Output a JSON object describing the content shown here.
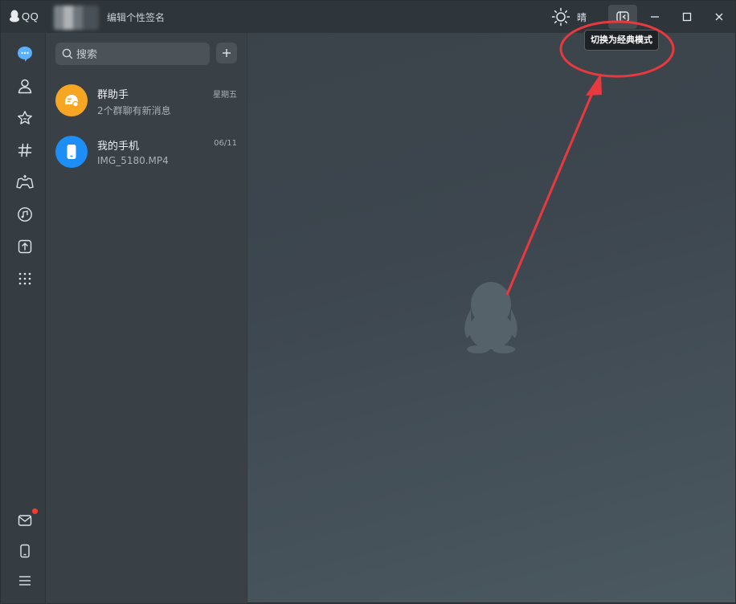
{
  "titlebar": {
    "logo_text": "QQ",
    "signature": "编辑个性签名",
    "weather_icon": "sun-icon",
    "weather_text": "晴",
    "switch_mode_icon": "switch-mode-icon",
    "tooltip": "切换为经典模式"
  },
  "nav": {
    "items": [
      {
        "name": "messages",
        "icon": "chat-bubble-icon"
      },
      {
        "name": "contacts",
        "icon": "person-icon"
      },
      {
        "name": "favorites",
        "icon": "star-icon"
      },
      {
        "name": "channels",
        "icon": "hashtag-icon"
      },
      {
        "name": "games",
        "icon": "gamepad-icon"
      },
      {
        "name": "music",
        "icon": "music-note-icon"
      },
      {
        "name": "files",
        "icon": "upload-file-icon"
      },
      {
        "name": "apps",
        "icon": "grid-dots-icon"
      }
    ],
    "bottom": [
      {
        "name": "mail",
        "icon": "mail-icon",
        "has_badge": true
      },
      {
        "name": "phone",
        "icon": "phone-icon"
      },
      {
        "name": "menu",
        "icon": "hamburger-menu-icon"
      }
    ],
    "accent_color": "#5ab0ff",
    "badge_color": "#ff3b30"
  },
  "search": {
    "placeholder": "搜索"
  },
  "chats": [
    {
      "name": "群助手",
      "preview": "2个群聊有新消息",
      "time": "星期五",
      "avatar_color": "#f7a623",
      "icon": "group-assistant-icon"
    },
    {
      "name": "我的手机",
      "preview": "IMG_5180.MP4",
      "time": "06/11",
      "avatar_color": "#1d8ef5",
      "icon": "phone-icon"
    }
  ],
  "main": {
    "watermark_icon": "qq-penguin-icon"
  },
  "annotation": {
    "color": "#e8393f"
  }
}
